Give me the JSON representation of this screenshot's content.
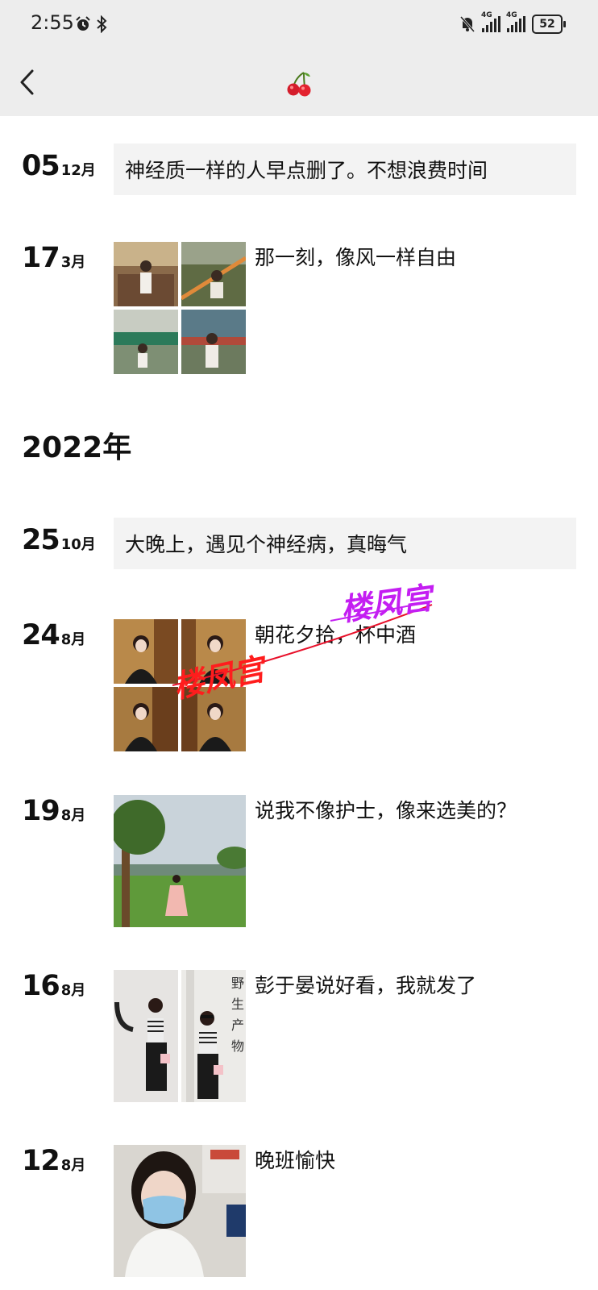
{
  "status_bar": {
    "time": "2:55",
    "network_1": "4G",
    "network_2": "4G",
    "battery": "52"
  },
  "header": {
    "back_icon": "chevron-left-icon",
    "title_icon": "cherry-icon"
  },
  "timeline": {
    "entries_top": [
      {
        "day": "05",
        "month": "12月",
        "text": "神经质一样的人早点删了。不想浪费时间"
      },
      {
        "day": "17",
        "month": "3月",
        "caption": "那一刻，像风一样自由"
      }
    ],
    "year_heading": "2022年",
    "entries_2022": [
      {
        "day": "25",
        "month": "10月",
        "text": "大晚上，遇见个神经病，真晦气"
      },
      {
        "day": "24",
        "month": "8月",
        "caption": "朝花夕拾，杯中酒"
      },
      {
        "day": "19",
        "month": "8月",
        "caption": "说我不像护士，像来选美的？"
      },
      {
        "day": "16",
        "month": "8月",
        "caption": "彭于晏说好看，我就发了"
      },
      {
        "day": "12",
        "month": "8月",
        "caption": "晚班愉快"
      }
    ]
  },
  "watermark": {
    "text_1": "楼凤宫",
    "text_2": "楼凤宫"
  },
  "colors": {
    "header_bg": "#ededed",
    "text_box_bg": "#f3f3f3",
    "watermark_red": "#ff1d1d",
    "watermark_purple": "#c41ef2"
  }
}
